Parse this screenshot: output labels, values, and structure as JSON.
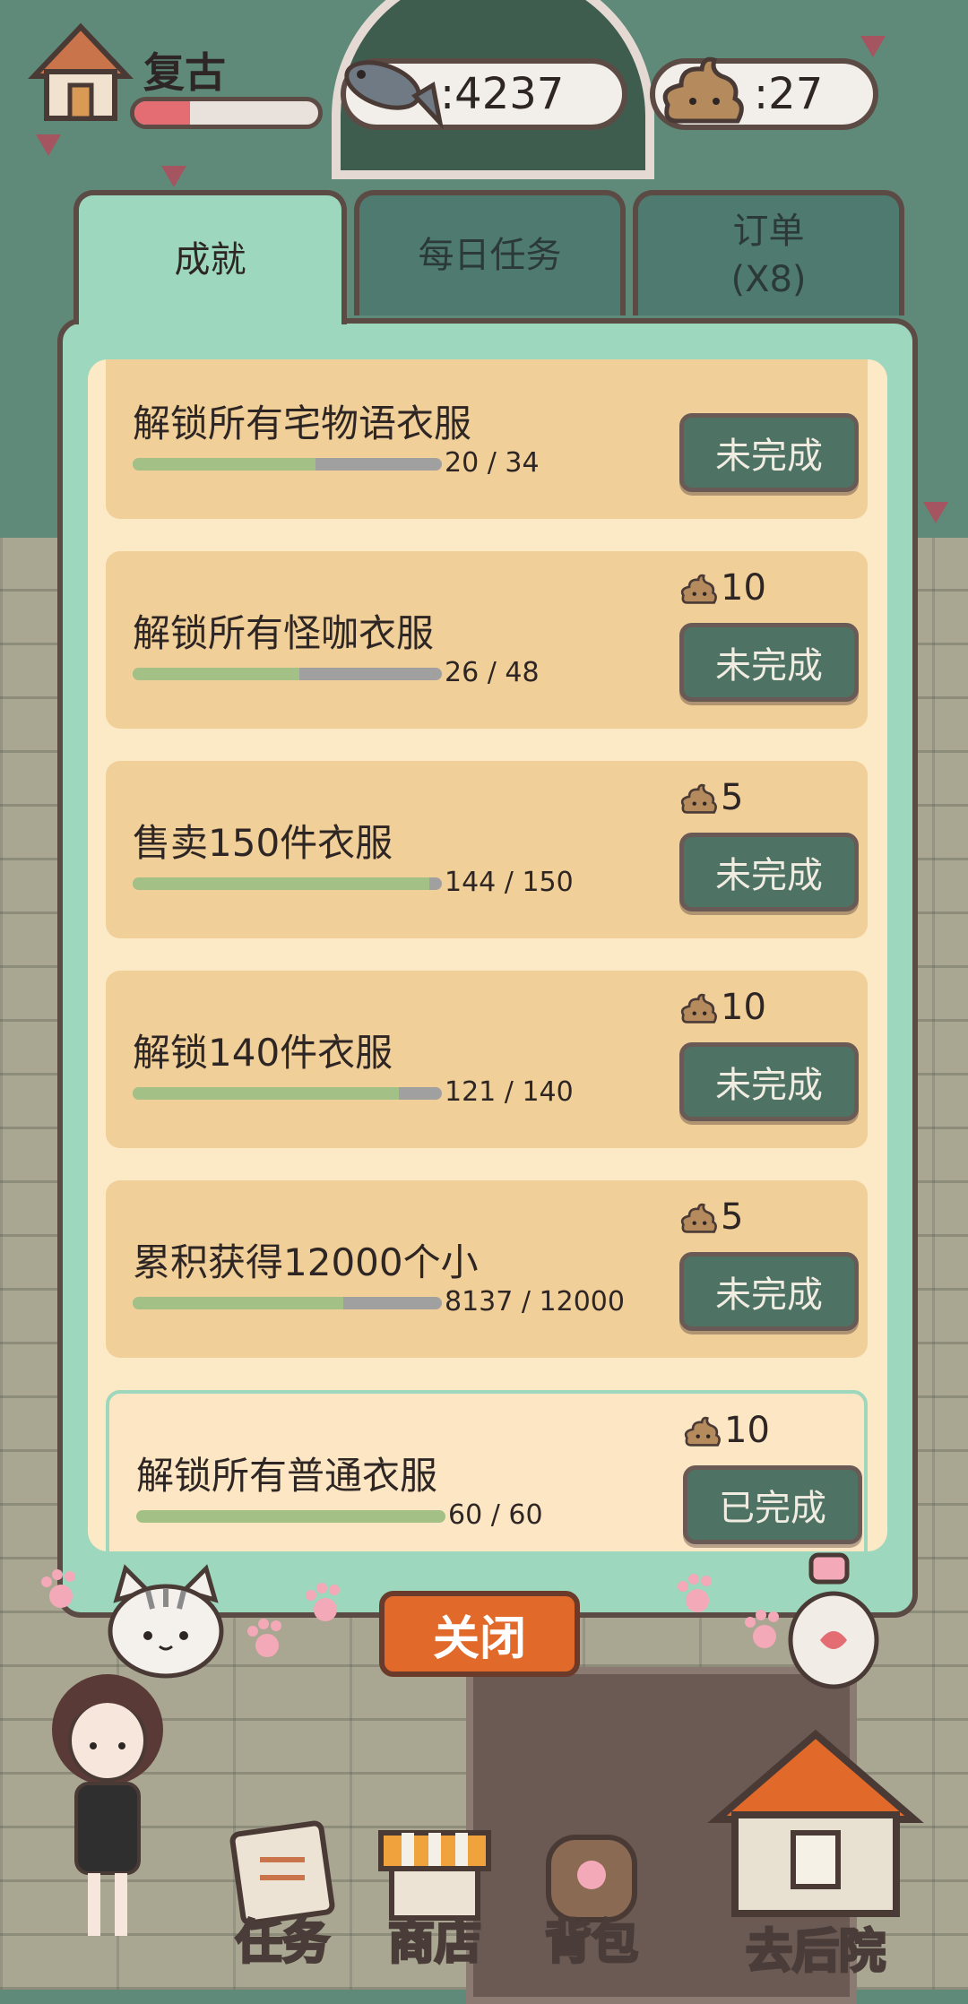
{
  "header": {
    "player_name": "复古",
    "xp_fraction": 0.3,
    "fish_count": ":4237",
    "poop_count": ":27"
  },
  "tabs": [
    {
      "label": "成就"
    },
    {
      "label": "每日任务"
    },
    {
      "label": "订单\n(X8)"
    }
  ],
  "achievements": [
    {
      "title": "解锁所有宅物语衣服",
      "progress": "20 / 34",
      "fraction": 0.59,
      "reward": "",
      "status": "未完成",
      "done": false
    },
    {
      "title": "解锁所有怪咖衣服",
      "progress": "26 / 48",
      "fraction": 0.54,
      "reward": "10",
      "status": "未完成",
      "done": false
    },
    {
      "title": "售卖150件衣服",
      "progress": "144 / 150",
      "fraction": 0.96,
      "reward": "5",
      "status": "未完成",
      "done": false
    },
    {
      "title": "解锁140件衣服",
      "progress": "121 / 140",
      "fraction": 0.86,
      "reward": "10",
      "status": "未完成",
      "done": false
    },
    {
      "title": "累积获得12000个小",
      "progress": "8137 / 12000",
      "fraction": 0.68,
      "reward": "5",
      "status": "未完成",
      "done": false
    },
    {
      "title": "解锁所有普通衣服",
      "progress": "60 / 60",
      "fraction": 1.0,
      "reward": "10",
      "status": "已完成",
      "done": true
    }
  ],
  "close_label": "关闭",
  "nav": {
    "task": "任务",
    "shop": "商店",
    "bag": "背包",
    "yard": "去后院"
  },
  "colors": {
    "panel": "#9dd7bd",
    "card": "#f0cf99",
    "button": "#4e7263",
    "close": "#e1692a",
    "xp": "#e46c73"
  }
}
